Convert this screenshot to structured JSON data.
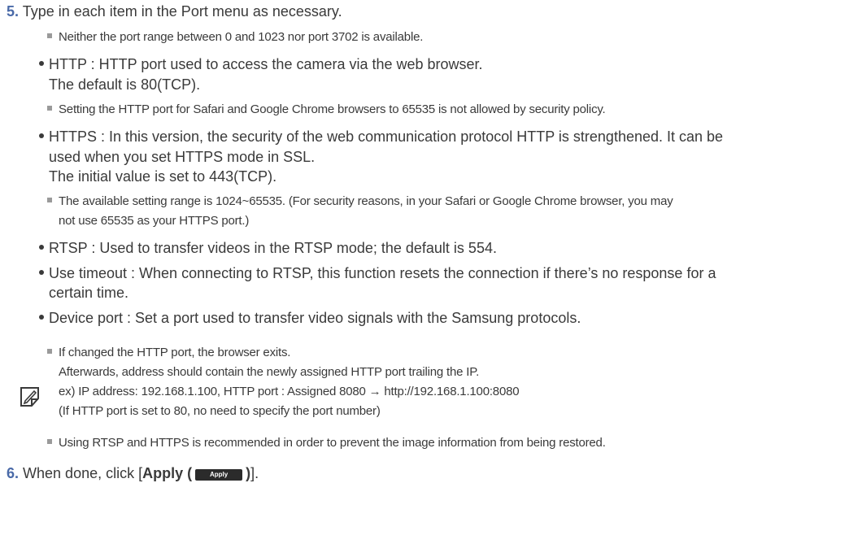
{
  "step5": {
    "num": "5.",
    "text": "Type in each item in the Port menu as necessary.",
    "note": "Neither the port range between 0 and 1023 nor port 3702 is available."
  },
  "http": {
    "line1": "HTTP : HTTP port used to access the camera via the web browser.",
    "line2": "The default is 80(TCP).",
    "note": "Setting the HTTP port for Safari and Google Chrome browsers to 65535 is not allowed by security policy."
  },
  "https": {
    "line1": "HTTPS : In this version, the security of the web communication protocol HTTP is strengthened. It can be",
    "line2": "used when you set HTTPS mode in SSL.",
    "line3": "The initial value is set to 443(TCP).",
    "note1": "The available setting range is 1024~65535. (For security reasons, in your Safari or Google Chrome browser, you may",
    "note2": "not use 65535 as your HTTPS port.)"
  },
  "rtsp": {
    "line1": "RTSP : Used to transfer videos in the RTSP mode; the default is 554."
  },
  "timeout": {
    "line1": "Use timeout : When connecting to RTSP, this function resets the connection if there’s no response for a",
    "line2": "certain time."
  },
  "device": {
    "line1": "Device port : Set a port used to transfer video signals with the Samsung protocols."
  },
  "memo": {
    "icon": "memo-note-icon",
    "item1_line1": "If changed the HTTP port, the browser exits.",
    "item1_line2": "Afterwards, address should contain the newly assigned HTTP port trailing the IP.",
    "item1_line3": "ex) IP address: 192.168.1.100, HTTP port : Assigned 8080 → http://192.168.1.100:8080",
    "item1_line4": "(If HTTP port is set to 80, no need to specify the port number)",
    "item2": "Using RTSP and HTTPS is recommended in order to prevent the image information from being restored."
  },
  "step6": {
    "num": "6.",
    "prefix": "When done, click [",
    "bold": "Apply (",
    "button": "Apply",
    "close": ")",
    "suffix": "]."
  },
  "colors": {
    "step_number": "#4a6aa8",
    "text": "#3a3a3a",
    "bullet_square": "#9a9a9a"
  }
}
